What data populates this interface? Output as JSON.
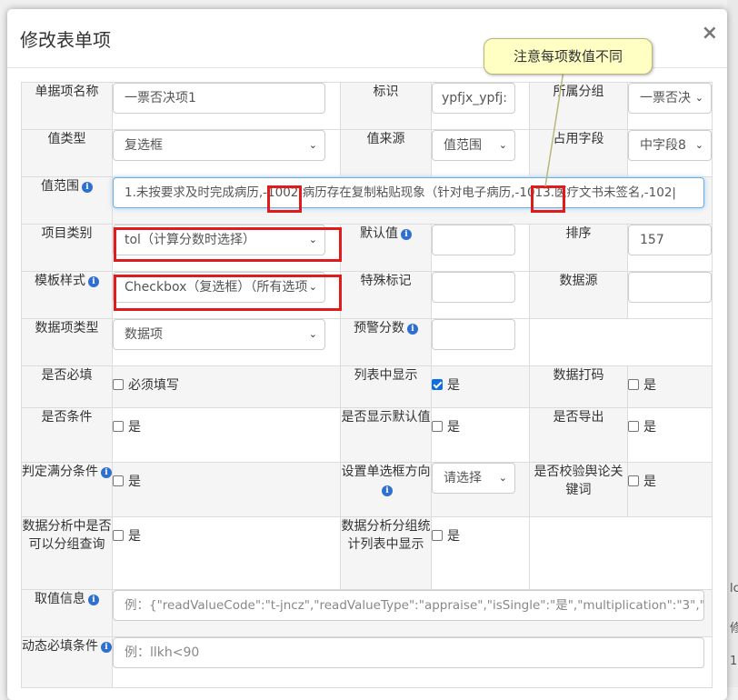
{
  "dialog": {
    "title": "修改表单项",
    "close_label": "×"
  },
  "annotation": {
    "note": "注意每项数值不同"
  },
  "fields": {
    "item_name": {
      "label": "单据项名称",
      "value": "一票否决项1"
    },
    "identifier": {
      "label": "标识",
      "value": "ypfjx_ypfj:"
    },
    "group": {
      "label": "所属分组",
      "value": "一票否决"
    },
    "value_type": {
      "label": "值类型",
      "value": "复选框"
    },
    "value_source": {
      "label": "值来源",
      "value": "值范围"
    },
    "field_slot": {
      "label": "占用字段",
      "value": "中字段8"
    },
    "value_range": {
      "label": "值范围",
      "value": "1.未按要求及时完成病历,-1002.病历存在复制粘贴现象（针对电子病历,-1013.医疗文书未签名,-102|"
    },
    "project_category": {
      "label": "项目类别",
      "value": "tol（计算分数时选择）"
    },
    "default_value": {
      "label": "默认值",
      "value": ""
    },
    "sort": {
      "label": "排序",
      "value": "157"
    },
    "template_style": {
      "label": "模板样式",
      "value": "Checkbox（复选框）（所有选项"
    },
    "special_mark": {
      "label": "特殊标记",
      "value": ""
    },
    "data_source": {
      "label": "数据源",
      "value": ""
    },
    "data_item_type": {
      "label": "数据项类型",
      "value": "数据项"
    },
    "warning_score": {
      "label": "预警分数",
      "value": ""
    },
    "required": {
      "label": "是否必填",
      "option": "必须填写",
      "checked": false
    },
    "show_in_list": {
      "label": "列表中显示",
      "option": "是",
      "checked": true
    },
    "data_code": {
      "label": "数据打码",
      "option": "是",
      "checked": false
    },
    "is_condition": {
      "label": "是否条件",
      "option": "是",
      "checked": false
    },
    "show_default": {
      "label": "是否显示默认值",
      "option": "是",
      "checked": false
    },
    "export": {
      "label": "是否导出",
      "option": "是",
      "checked": false
    },
    "full_score_condition": {
      "label": "判定满分条件",
      "option": "是",
      "checked": false
    },
    "radio_direction": {
      "label": "设置单选框方向",
      "value": "请选择"
    },
    "verify_keywords": {
      "label": "是否校验舆论关键词",
      "option": "是",
      "checked": false
    },
    "group_query": {
      "label": "数据分析中是否可以分组查询",
      "option": "是",
      "checked": false
    },
    "group_stats": {
      "label": "数据分析分组统计列表中显示",
      "option": "是",
      "checked": false
    },
    "value_info": {
      "label": "取值信息",
      "placeholder": "例：{\"readValueCode\":\"t-jncz\",\"readValueType\":\"appraise\",\"isSingle\":\"是\",\"multiplication\":\"3\",\"c"
    },
    "dynamic_required": {
      "label": "动态必填条件",
      "placeholder": "例：llkh<90"
    }
  },
  "background": {
    "fragments": [
      "lc",
      "修",
      "1"
    ]
  },
  "colors": {
    "accent": "#0b6ee6",
    "highlight_border": "#e01b1b",
    "tooltip_bg": "#ffffc4",
    "info_icon": "#2f6fcf"
  },
  "icons": {
    "info": "info-circle-icon",
    "caret": "chevron-down-icon",
    "close": "close-icon"
  }
}
